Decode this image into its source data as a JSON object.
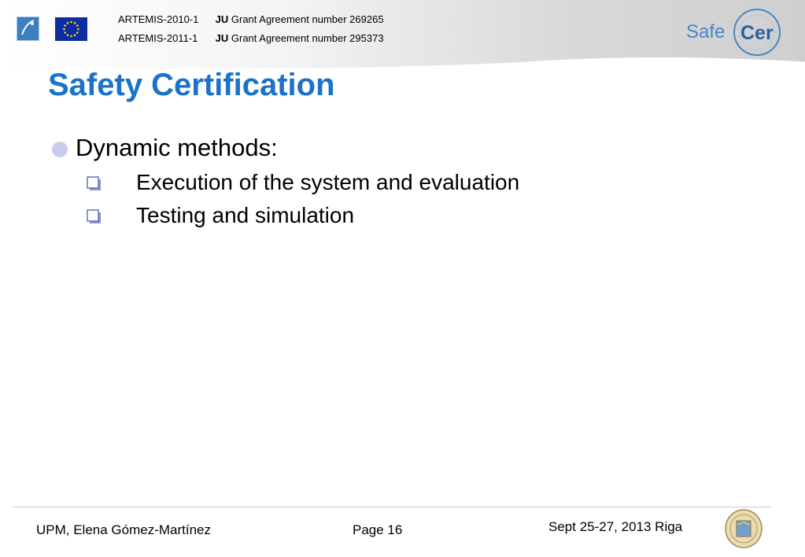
{
  "header": {
    "grant_lines": [
      {
        "program": "ARTEMIS-2010-1",
        "ju": "JU",
        "text": "Grant Agreement number 269265"
      },
      {
        "program": "ARTEMIS-2011-1",
        "ju": "JU",
        "text": "Grant Agreement number 295373"
      }
    ],
    "logos": {
      "artemis": "ARTEMIS",
      "safecer_left": "Safe",
      "safecer_right": "Cer"
    }
  },
  "slide": {
    "title": "Safety Certification",
    "bullet": "Dynamic methods:",
    "sub_bullets": [
      "Execution of the system and evaluation",
      "Testing  and simulation"
    ]
  },
  "footer": {
    "author": "UPM, Elena Gómez-Martínez",
    "page": "Page 16",
    "date": "Sept 25-27, 2013 Riga"
  },
  "colors": {
    "title": "#1a73c8",
    "bullet_dot": "#c8cdf0",
    "safecer_blue": "#4a86c5"
  }
}
